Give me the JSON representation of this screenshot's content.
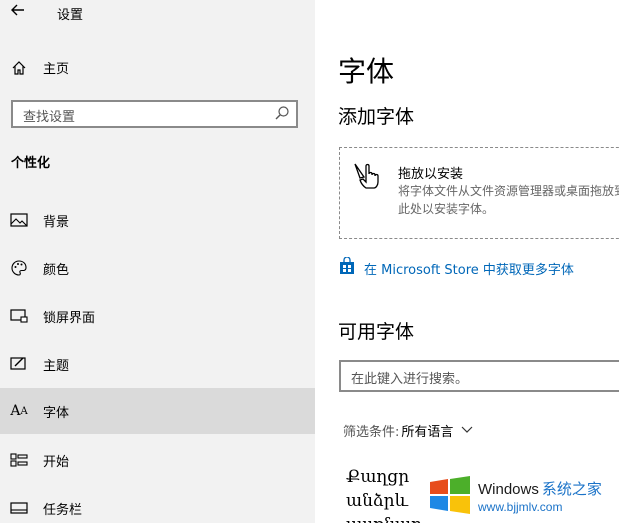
{
  "window": {
    "title": "设置",
    "back_icon": "back-arrow-icon"
  },
  "sidebar": {
    "home_label": "主页",
    "search_placeholder": "查找设置",
    "section_title": "个性化",
    "items": [
      {
        "label": "背景",
        "icon": "image-icon",
        "selected": false
      },
      {
        "label": "颜色",
        "icon": "palette-icon",
        "selected": false
      },
      {
        "label": "锁屏界面",
        "icon": "lock-screen-icon",
        "selected": false
      },
      {
        "label": "主题",
        "icon": "theme-icon",
        "selected": false
      },
      {
        "label": "字体",
        "icon": "font-icon",
        "selected": true
      },
      {
        "label": "开始",
        "icon": "start-icon",
        "selected": false
      },
      {
        "label": "任务栏",
        "icon": "taskbar-icon",
        "selected": false
      }
    ]
  },
  "main": {
    "title": "字体",
    "add_fonts_heading": "添加字体",
    "drop_title": "拖放以安装",
    "drop_desc": "将字体文件从文件资源管理器或桌面拖放到此处以安装字体。",
    "store_link": "在 Microsoft Store 中获取更多字体",
    "available_heading": "可用字体",
    "search_placeholder": "在此键入进行搜索。",
    "filter_label": "筛选条件:",
    "filter_value": "所有语言",
    "preview_lines": [
      "Քաղցր",
      "անձրև",
      "սառնար"
    ]
  },
  "watermark": {
    "line1": "Windows",
    "line1_suffix": "系统之家",
    "line2": "www.bjjmlv.com"
  },
  "colors": {
    "sidebar_bg": "#f2f2f2",
    "selected_bg": "#dadada",
    "link": "#0067b8"
  }
}
